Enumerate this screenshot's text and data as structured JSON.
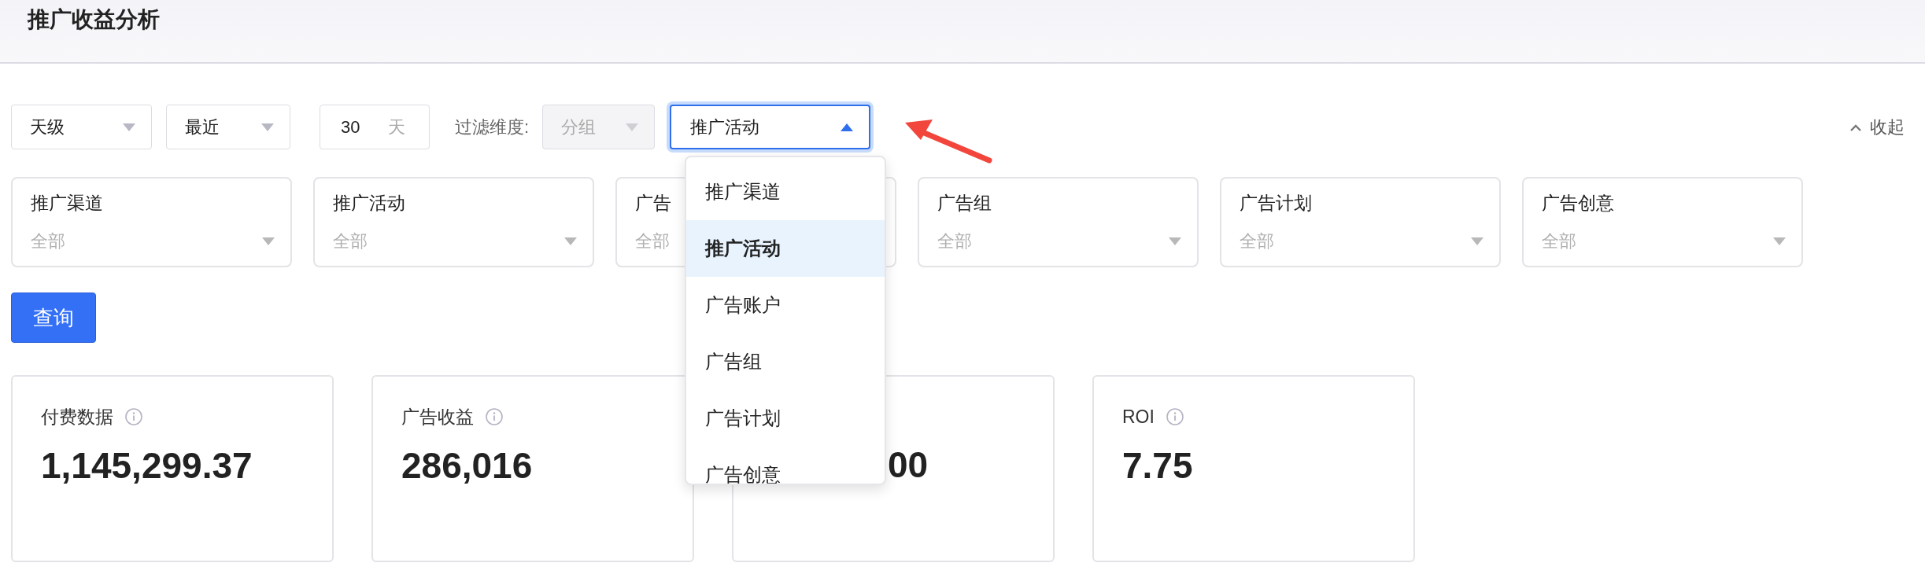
{
  "page_title": "推广收益分析",
  "toolbar": {
    "granularity": {
      "value": "天级"
    },
    "range": {
      "value": "最近"
    },
    "days": {
      "value": "30",
      "unit": "天"
    },
    "filter_label": "过滤维度:",
    "group_select": {
      "value": "分组",
      "disabled": true
    },
    "dimension_select": {
      "value": "推广活动",
      "expanded": true
    },
    "collapse": "收起"
  },
  "filters": [
    {
      "label": "推广渠道",
      "placeholder": "全部"
    },
    {
      "label": "推广活动",
      "placeholder": "全部"
    },
    {
      "label": "广告",
      "placeholder": "全部"
    },
    {
      "label": "广告组",
      "placeholder": "全部"
    },
    {
      "label": "广告计划",
      "placeholder": "全部"
    },
    {
      "label": "广告创意",
      "placeholder": "全部"
    }
  ],
  "query_button": "查询",
  "dropdown": {
    "items": [
      {
        "label": "推广渠道",
        "selected": false
      },
      {
        "label": "推广活动",
        "selected": true
      },
      {
        "label": "广告账户",
        "selected": false
      },
      {
        "label": "广告组",
        "selected": false
      },
      {
        "label": "广告计划",
        "selected": false
      },
      {
        "label": "广告创意",
        "selected": false
      }
    ]
  },
  "stats": [
    {
      "label": "付费数据",
      "value": "1,145,299.37",
      "kind": "full"
    },
    {
      "label": "广告收益",
      "value": "286,016",
      "kind": "full"
    },
    {
      "value": "00",
      "kind": "covered"
    },
    {
      "label": "ROI",
      "value": "7.75",
      "kind": "full"
    }
  ]
}
